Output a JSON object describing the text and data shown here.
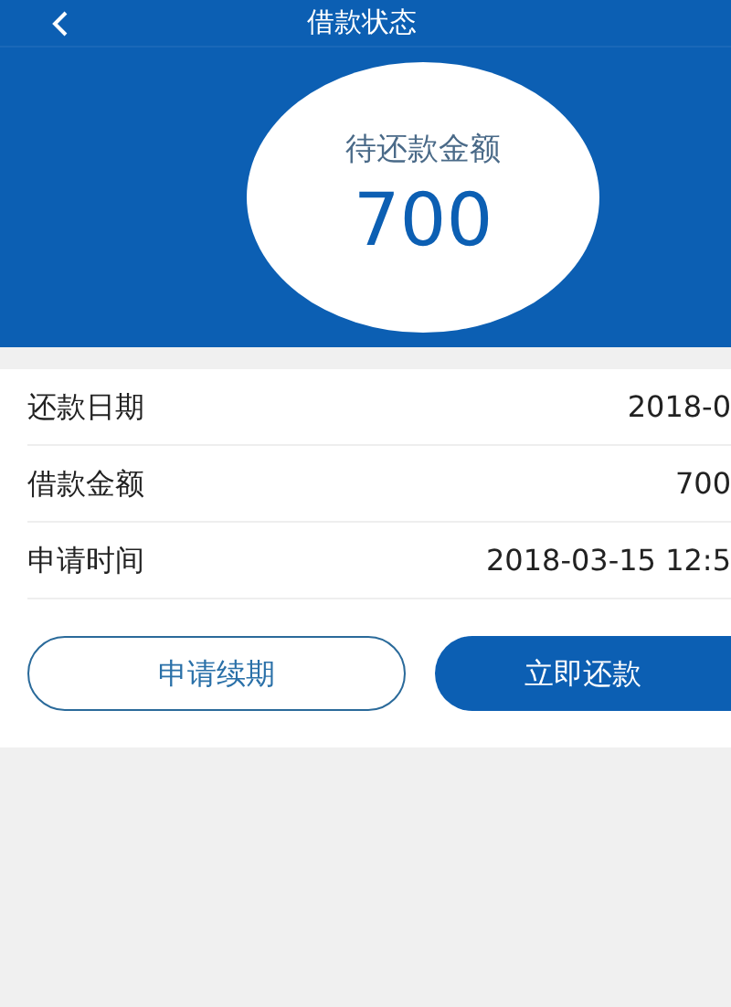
{
  "header": {
    "title": "借款状态"
  },
  "summary": {
    "label": "待还款金额",
    "amount": "700"
  },
  "details": [
    {
      "label": "还款日期",
      "value": "2018-0"
    },
    {
      "label": "借款金额",
      "value": "700"
    },
    {
      "label": "申请时间",
      "value": "2018-03-15 12:5"
    }
  ],
  "buttons": [
    {
      "label": "申请续期",
      "kind": "outline"
    },
    {
      "label": "立即还款",
      "kind": "filled"
    }
  ]
}
